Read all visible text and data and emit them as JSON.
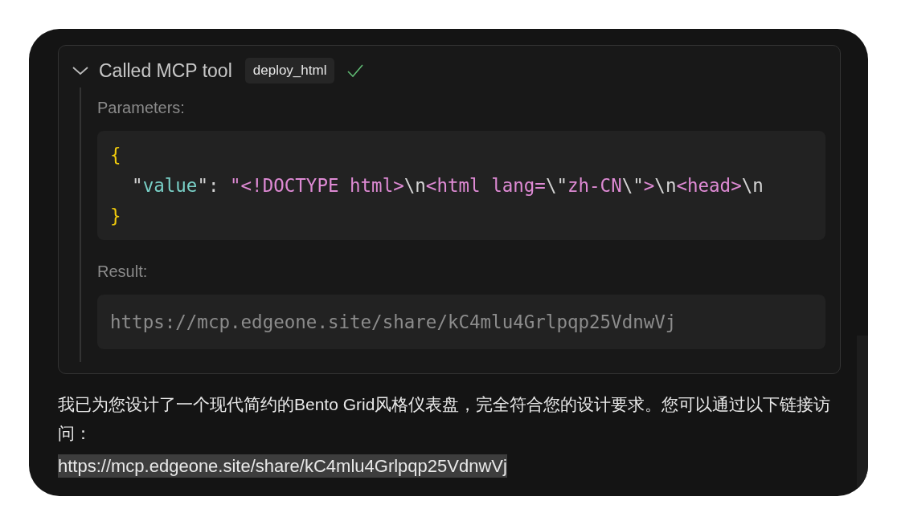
{
  "tool_call": {
    "expanded": true,
    "title": "Called MCP tool",
    "tool_name": "deploy_html",
    "succeeded": true,
    "parameters_label": "Parameters:",
    "parameters_code": [
      [
        {
          "kind": "brace",
          "text": "{"
        }
      ],
      [
        {
          "kind": "plain",
          "text": "  \""
        },
        {
          "kind": "key",
          "text": "value"
        },
        {
          "kind": "plain",
          "text": "\": "
        },
        {
          "kind": "string",
          "text": "\"<!DOCTYPE html>"
        },
        {
          "kind": "plain",
          "text": "\\n"
        },
        {
          "kind": "string",
          "text": "<html lang="
        },
        {
          "kind": "plain",
          "text": "\\\""
        },
        {
          "kind": "string",
          "text": "zh-CN"
        },
        {
          "kind": "plain",
          "text": "\\\""
        },
        {
          "kind": "string",
          "text": ">"
        },
        {
          "kind": "plain",
          "text": "\\n"
        },
        {
          "kind": "string",
          "text": "<head>"
        },
        {
          "kind": "plain",
          "text": "\\n"
        }
      ],
      [
        {
          "kind": "brace",
          "text": "}"
        }
      ]
    ],
    "result_label": "Result:",
    "result": "https://mcp.edgeone.site/share/kC4mlu4Grlpqp25VdnwVj"
  },
  "message": {
    "text": "我已为您设计了一个现代简约的Bento Grid风格仪表盘，完全符合您的设计要求。您可以通过以下链接访问：",
    "link": {
      "text": "https://mcp.edgeone.site/share/kC4mlu4Grlpqp25VdnwVj",
      "highlighted": true
    }
  }
}
